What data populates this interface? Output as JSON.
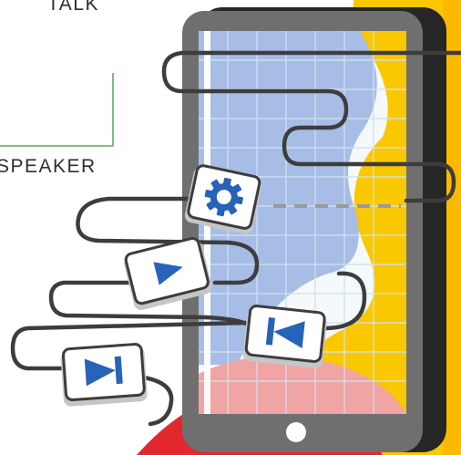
{
  "labels": {
    "talk": "TALK",
    "speaker": "SPEAKER"
  },
  "colors": {
    "outline": "#3d3d3d",
    "device": "#6f6f6f",
    "device_shadow": "#262626",
    "blue": "#a7bde6",
    "yellow": "#f9c800",
    "red": "#e2282d",
    "pink": "#f0a4a4",
    "grid": "#d0e3ee",
    "icon_blue": "#2763b8",
    "accent_line": "#57a66a"
  },
  "controls": [
    {
      "name": "settings-button",
      "icon": "gear-icon"
    },
    {
      "name": "play-button",
      "icon": "play-icon"
    },
    {
      "name": "previous-button",
      "icon": "skip-previous-icon"
    },
    {
      "name": "next-button",
      "icon": "skip-next-icon"
    }
  ]
}
